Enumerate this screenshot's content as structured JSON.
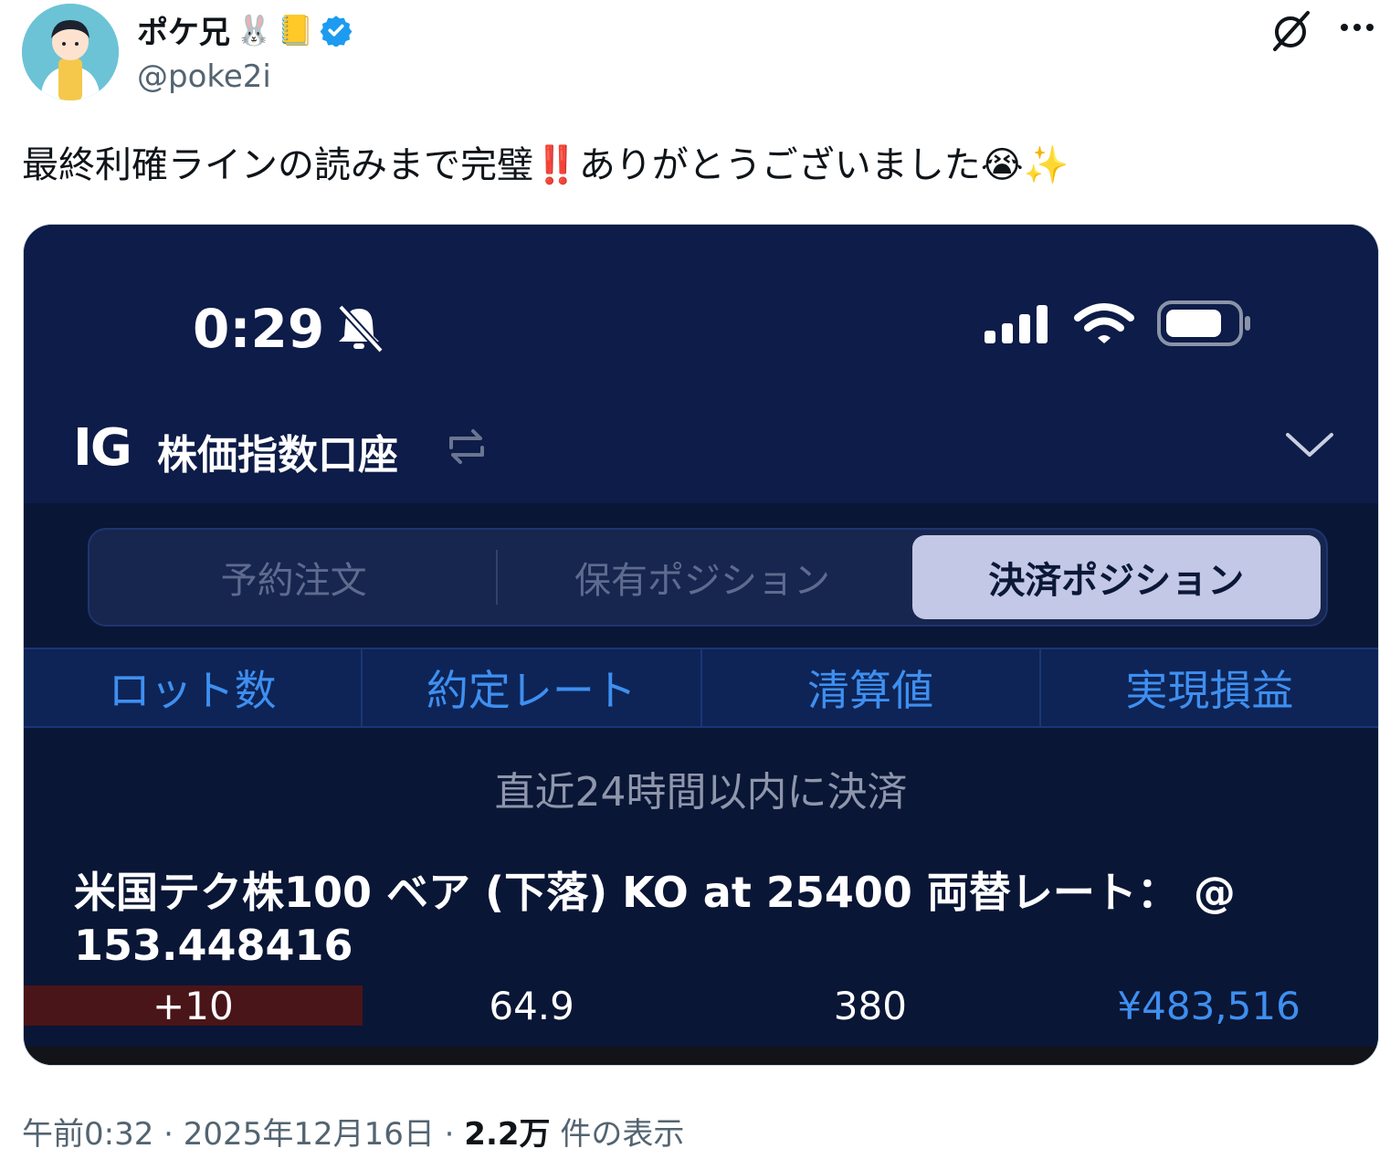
{
  "post": {
    "display_name": "ポケ兄",
    "handle": "@poke2i",
    "text_main": "最終利確ラインの読みまで完璧",
    "text_after": "ありがとうございました",
    "emoji_exclaim": "‼️",
    "emoji_cry": "😭",
    "emoji_sparkles": "✨",
    "name_emoji_1": "🐰",
    "name_emoji_2": "📒",
    "verified_icon": "verified-badge-icon",
    "more_icon": "more-icon",
    "grok_icon": "grok-icon"
  },
  "screenshot": {
    "status_bar": {
      "time": "0:29"
    },
    "header": {
      "logo": "IG",
      "account": "株価指数口座"
    },
    "tabs": [
      {
        "label": "予約注文",
        "active": false
      },
      {
        "label": "保有ポジション",
        "active": false
      },
      {
        "label": "決済ポジション",
        "active": true
      }
    ],
    "columns": [
      "ロット数",
      "約定レート",
      "清算値",
      "実現損益"
    ],
    "group_label": "直近24時間以内に決済",
    "instrument": "米国テク株100 ベア (下落) KO at 25400 両替レート： @ 153.448416",
    "row": {
      "lots": "+10",
      "rate": "64.9",
      "close": "380",
      "pnl": "¥483,516"
    }
  },
  "meta": {
    "time": "午前0:32",
    "date": "2025年12月16日",
    "views": "2.2万",
    "views_label": "件の表示"
  },
  "colors": {
    "accent_blue": "#3e8ff0",
    "verified": "#1d9bf0",
    "app_bg": "#0d1c48"
  }
}
